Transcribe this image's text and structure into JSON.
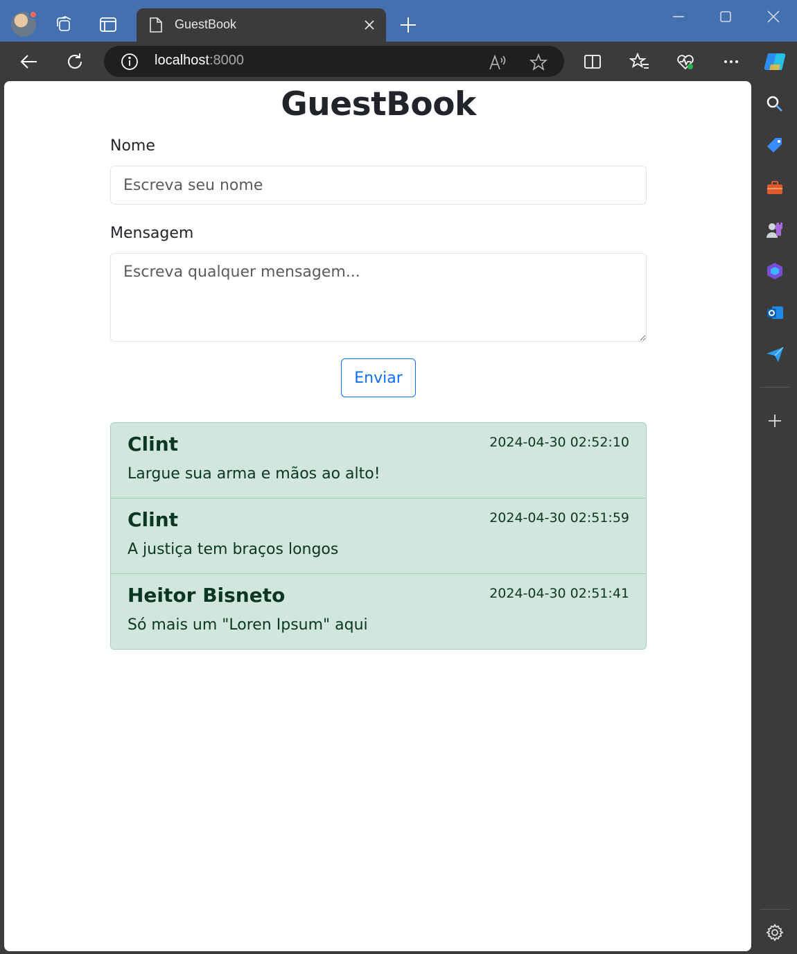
{
  "browser": {
    "tab_title": "GuestBook",
    "url_host": "localhost",
    "url_port": ":8000"
  },
  "page": {
    "title": "GuestBook",
    "form": {
      "name_label": "Nome",
      "name_placeholder": "Escreva seu nome",
      "message_label": "Mensagem",
      "message_placeholder": "Escreva qualquer mensagem...",
      "submit_label": "Enviar"
    },
    "entries": [
      {
        "name": "Clint",
        "timestamp": "2024-04-30 02:52:10",
        "message": "Largue sua arma e mãos ao alto!"
      },
      {
        "name": "Clint",
        "timestamp": "2024-04-30 02:51:59",
        "message": "A justiça tem braços longos"
      },
      {
        "name": "Heitor Bisneto",
        "timestamp": "2024-04-30 02:51:41",
        "message": "Só mais um \"Loren Ipsum\" aqui"
      }
    ]
  },
  "colors": {
    "titlebar": "#4470b0",
    "chrome": "#3b3b3b",
    "primary": "#0d6efd",
    "entry_bg": "#d1e7dd",
    "entry_text": "#0a3622"
  }
}
